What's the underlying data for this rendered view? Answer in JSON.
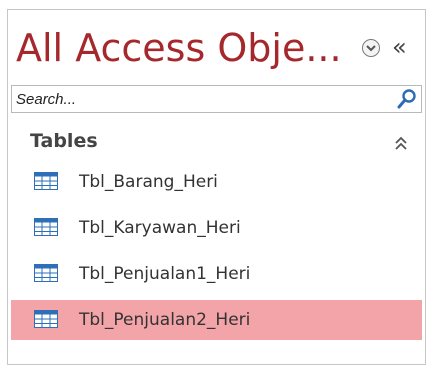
{
  "navigation_pane": {
    "title": "All Access Obje...",
    "menu_icon": "chevron-down-circle-icon",
    "shutter_icon": "double-chevron-left-icon",
    "shutter_glyph": "«"
  },
  "search": {
    "placeholder": "Search...",
    "value": "",
    "icon": "search-icon"
  },
  "group": {
    "label": "Tables",
    "collapse_icon": "double-chevron-up-icon"
  },
  "items": [
    {
      "label": "Tbl_Barang_Heri",
      "selected": false,
      "icon": "table-icon"
    },
    {
      "label": "Tbl_Karyawan_Heri",
      "selected": false,
      "icon": "table-icon"
    },
    {
      "label": "Tbl_Penjualan1_Heri",
      "selected": false,
      "icon": "table-icon"
    },
    {
      "label": "Tbl_Penjualan2_Heri",
      "selected": true,
      "icon": "table-icon"
    }
  ],
  "colors": {
    "title": "#a5282c",
    "selection": "#f2a4a8",
    "table_icon_header": "#2e6fb8"
  }
}
